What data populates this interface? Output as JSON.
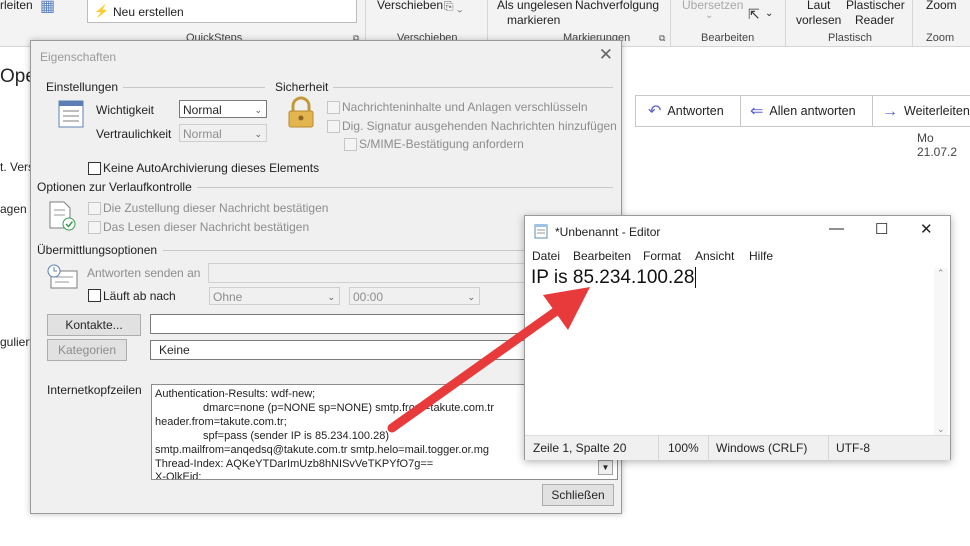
{
  "ribbon": {
    "partial_left": "rleiten",
    "new_item": "Neu erstellen",
    "quicksteps": "QuickSteps",
    "move": "Verschieben",
    "move_group": "Verschieben",
    "mark_unread": "Als ungelesen",
    "mark_line2": "markieren",
    "followup": "Nachverfolgung",
    "tags_group": "Markierungen",
    "translate": "Übersetzen",
    "edit_group": "Bearbeiten",
    "read_aloud_1": "Laut",
    "read_aloud_2": "vorlesen",
    "immersive_1": "Plastischer",
    "immersive_2": "Reader",
    "speech_group": "Plastisch",
    "zoom": "Zoom",
    "zoom_group": "Zoom"
  },
  "background": {
    "left_fragments": [
      "Ope",
      "t. Vers",
      "agen",
      "guliert"
    ],
    "reply": "Antworten",
    "reply_all": "Allen antworten",
    "forward": "Weiterleiten",
    "date": "Mo 21.07.2"
  },
  "properties": {
    "title": "Eigenschaften",
    "settings_header": "Einstellungen",
    "security_header": "Sicherheit",
    "importance_label": "Wichtigkeit",
    "importance_value": "Normal",
    "sensitivity_label": "Vertraulichkeit",
    "sensitivity_value": "Normal",
    "encrypt": "Nachrichteninhalte und Anlagen verschlüsseln",
    "sign": "Dig. Signatur ausgehenden Nachrichten hinzufügen",
    "smime": "S/MIME-Bestätigung anfordern",
    "no_autoarchive": "Keine AutoArchivierung dieses Elements",
    "tracking_header": "Optionen zur Verlaufkontrolle",
    "delivery_receipt": "Die Zustellung dieser Nachricht bestätigen",
    "read_receipt": "Das Lesen dieser Nachricht bestätigen",
    "delivery_header": "Übermittlungsoptionen",
    "reply_to": "Antworten senden an",
    "expires": "Läuft ab nach",
    "expires_date": "Ohne",
    "expires_time": "00:00",
    "contacts_button": "Kontakte...",
    "categories_button": "Kategorien",
    "categories_value": "Keine",
    "headers_label": "Internetkopfzeilen",
    "headers": [
      "Authentication-Results: wdf-new;",
      "dmarc=none (p=NONE sp=NONE) smtp.from=takute.com.tr",
      "header.from=takute.com.tr;",
      "spf=pass (sender IP is 85.234.100.28)",
      "smtp.mailfrom=anqedsq@takute.com.tr smtp.helo=mail.togger.or.mg",
      "Thread-Index: AQKeYTDarImUzb8hNISvVeTKPYfO7g==",
      "X-OlkEid:"
    ],
    "close_button": "Schließen"
  },
  "notepad": {
    "title": "*Unbenannt - Editor",
    "menu": [
      "Datei",
      "Bearbeiten",
      "Format",
      "Ansicht",
      "Hilfe"
    ],
    "content": "IP is 85.234.100.28",
    "status_position": "Zeile 1, Spalte 20",
    "status_zoom": "100%",
    "status_eol": "Windows (CRLF)",
    "status_encoding": "UTF-8"
  },
  "colors": {
    "arrow": "#e8393b",
    "accent": "#5a5fd0"
  }
}
